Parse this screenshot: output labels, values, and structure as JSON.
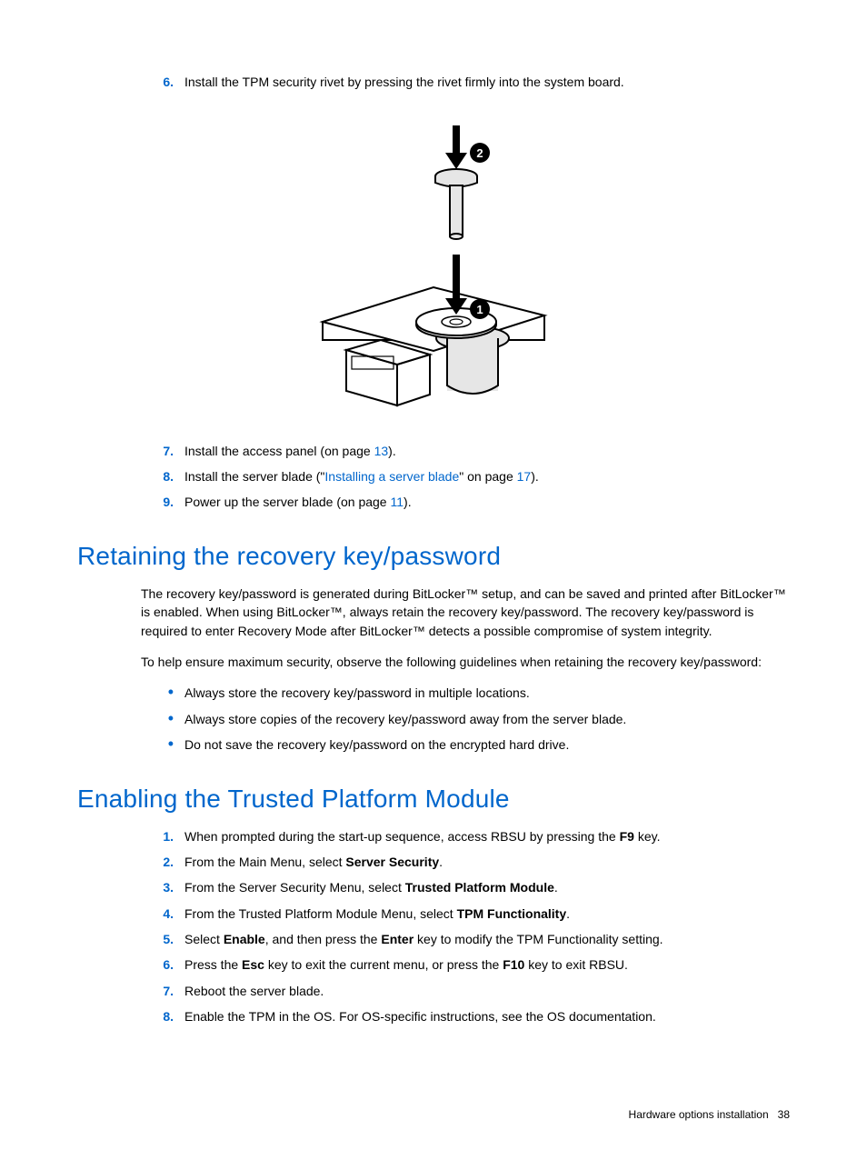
{
  "steps_a": {
    "s6": {
      "n": "6.",
      "t": "Install the TPM security rivet by pressing the rivet firmly into the system board."
    },
    "s7": {
      "n": "7.",
      "t1": "Install the access panel (on page ",
      "link": "13",
      "t2": ")."
    },
    "s8": {
      "n": "8.",
      "t1": "Install the server blade (\"",
      "link1": "Installing a server blade",
      "t2": "\" on page ",
      "link2": "17",
      "t3": ")."
    },
    "s9": {
      "n": "9.",
      "t1": "Power up the server blade (on page ",
      "link": "11",
      "t2": ")."
    }
  },
  "h_retain": "Retaining the recovery key/password",
  "p_retain1": "The recovery key/password is generated during BitLocker™ setup, and can be saved and printed after BitLocker™ is enabled. When using BitLocker™, always retain the recovery key/password. The recovery key/password is required to enter Recovery Mode after BitLocker™ detects a possible compromise of system integrity.",
  "p_retain2": "To help ensure maximum security, observe the following guidelines when retaining the recovery key/password:",
  "bullets": {
    "b1": "Always store the recovery key/password in multiple locations.",
    "b2": "Always store copies of the recovery key/password away from the server blade.",
    "b3": "Do not save the recovery key/password on the encrypted hard drive."
  },
  "h_enable": "Enabling the Trusted Platform Module",
  "en": {
    "s1": {
      "n": "1.",
      "t1": "When prompted during the start-up sequence, access RBSU by pressing the ",
      "b1": "F9",
      "t2": " key."
    },
    "s2": {
      "n": "2.",
      "t1": "From the Main Menu, select ",
      "b1": "Server Security",
      "t2": "."
    },
    "s3": {
      "n": "3.",
      "t1": "From the Server Security Menu, select ",
      "b1": "Trusted Platform Module",
      "t2": "."
    },
    "s4": {
      "n": "4.",
      "t1": "From the Trusted Platform Module Menu, select ",
      "b1": "TPM Functionality",
      "t2": "."
    },
    "s5": {
      "n": "5.",
      "t1": "Select ",
      "b1": "Enable",
      "t2": ", and then press the ",
      "b2": "Enter",
      "t3": " key to modify the TPM Functionality setting."
    },
    "s6": {
      "n": "6.",
      "t1": "Press the ",
      "b1": "Esc",
      "t2": " key to exit the current menu, or press the ",
      "b2": "F10",
      "t3": " key to exit RBSU."
    },
    "s7": {
      "n": "7.",
      "t": "Reboot the server blade."
    },
    "s8": {
      "n": "8.",
      "t": "Enable the TPM in the OS. For OS-specific instructions, see the OS documentation."
    }
  },
  "footer": {
    "section": "Hardware options installation",
    "page": "38"
  },
  "callout": {
    "c1": "1",
    "c2": "2"
  }
}
